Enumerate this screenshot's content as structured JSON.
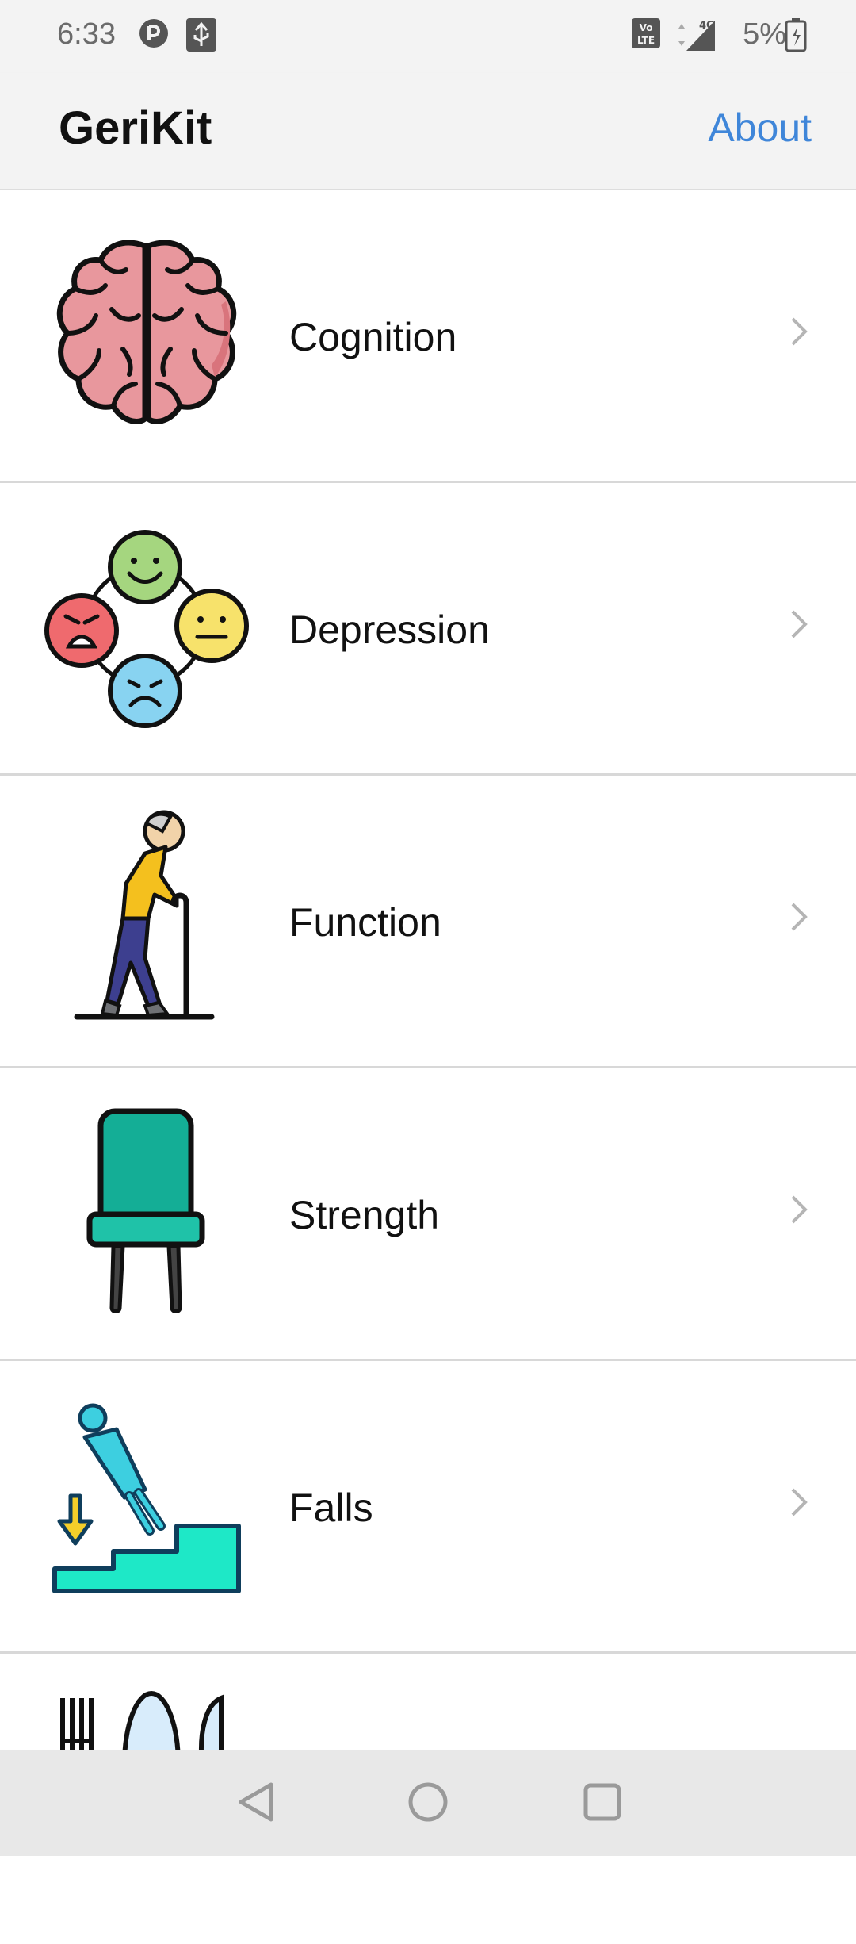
{
  "status_bar": {
    "time": "6:33",
    "battery": "5%"
  },
  "app_bar": {
    "title": "GeriKit",
    "about_label": "About"
  },
  "items": [
    {
      "label": "Cognition",
      "icon": "brain-icon"
    },
    {
      "label": "Depression",
      "icon": "mood-faces-icon"
    },
    {
      "label": "Function",
      "icon": "elderly-walking-cane-icon"
    },
    {
      "label": "Strength",
      "icon": "chair-icon"
    },
    {
      "label": "Falls",
      "icon": "falling-stairs-icon"
    }
  ],
  "nav": {
    "back": "back-triangle-icon",
    "home": "home-circle-icon",
    "recents": "recents-square-icon"
  },
  "colors": {
    "accent": "#3f86d9",
    "background": "#ffffff",
    "bar": "#f3f3f3"
  }
}
